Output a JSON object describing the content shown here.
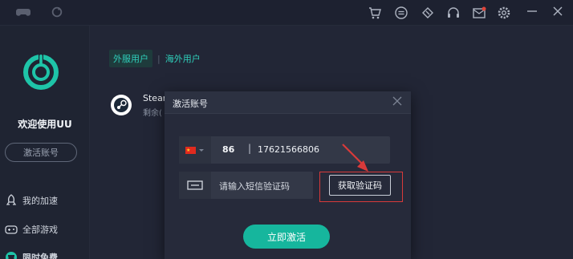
{
  "sidebar": {
    "welcome": "欢迎使用UU",
    "activate_account": "激活账号",
    "nav": [
      {
        "label": "我的加速",
        "icon": "rocket-icon"
      },
      {
        "label": "全部游戏",
        "icon": "gamepad-icon"
      },
      {
        "label": "限时免费",
        "icon": "gift-icon"
      }
    ]
  },
  "header": {
    "icons": [
      "cart-icon",
      "message-icon",
      "ticket-icon",
      "headset-icon",
      "mail-icon",
      "gear-icon"
    ]
  },
  "main": {
    "tabs": [
      "外服用户",
      "海外用户"
    ],
    "steam": {
      "name": "Steam",
      "sub": "剩余("
    }
  },
  "modal": {
    "title": "激活账号",
    "country_code": "86",
    "separator": "|",
    "phone": "17621566806",
    "code_placeholder": "请输入短信验证码",
    "get_code": "获取验证码",
    "submit": "立即激活"
  },
  "colors": {
    "accent": "#16b69d",
    "highlight": "#d83a3a",
    "background": "#1b1f2b"
  }
}
